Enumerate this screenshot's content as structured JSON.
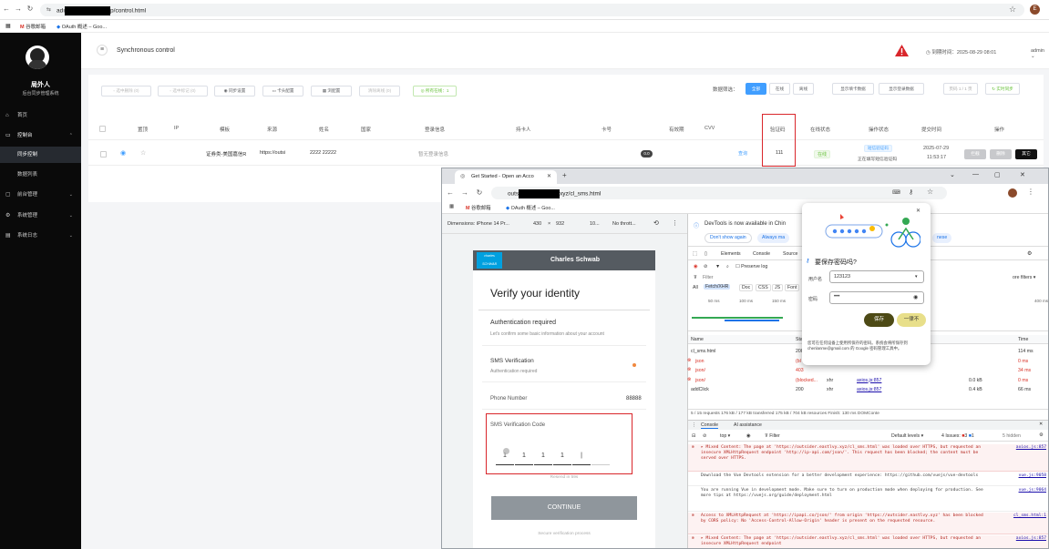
{
  "browser": {
    "url_prefix": "adı",
    "url_suffix": "p/control.html",
    "profile_initial": "E",
    "star": "☆",
    "bookmarks": [
      {
        "icon": "M",
        "label": "谷歌邮箱"
      },
      {
        "icon": "◆",
        "label": "OAuth 概述 – Goo..."
      }
    ]
  },
  "sidebar": {
    "brand_name": "局外人",
    "brand_sub": "后台同步管理系统",
    "items": [
      {
        "label": "首页",
        "icon": "⌂",
        "arrow": ""
      },
      {
        "label": "控制台",
        "icon": "▭",
        "arrow": "⌃"
      },
      {
        "label": "同步控制",
        "icon": "",
        "arrow": ""
      },
      {
        "label": "数据列表",
        "icon": "",
        "arrow": ""
      },
      {
        "label": "前台管理",
        "icon": "▢",
        "arrow": "⌄"
      },
      {
        "label": "系统管理",
        "icon": "⚙",
        "arrow": "⌄"
      },
      {
        "label": "系统日志",
        "icon": "▤",
        "arrow": "⌄"
      }
    ]
  },
  "header": {
    "menu_icon": "≡",
    "title": "Synchronous control",
    "expire_label": "到期时间：2025-08-29 08:01",
    "user": "admin",
    "user_arrow": "⌄"
  },
  "toolbar": {
    "buttons": [
      "选中删除 (0)",
      "选中标记 (0)",
      "同步设置",
      "卡头配置",
      "浏配置",
      "清除离线 (0)",
      "所有在线：1"
    ],
    "filter_label": "数据筛选：",
    "filter_all": "全部",
    "filter_online": "在线",
    "filter_offline": "离线",
    "show_card": "显示填卡数据",
    "show_login": "显示登录数据",
    "pager": "页码 1 / 1 页",
    "realtime": "实时同步"
  },
  "table": {
    "headers": [
      "置顶",
      "IP",
      "模板",
      "来源",
      "姓名",
      "国家",
      "登录信息",
      "持卡人",
      "卡号",
      "有效期",
      "CVV",
      "验证码",
      "在线状态",
      "操作状态",
      "提交时间",
      "操作"
    ],
    "row": {
      "template": "证券类-美国嘉信R",
      "source": "https://outsi",
      "name": "2222 22222",
      "login_info": "暂无登录信息",
      "card_badge": "0.0",
      "cvv_link": "查询",
      "code": "111",
      "online": "在线",
      "op_status_tag": "短信验证码",
      "op_status_text": "正在填写短信验证码",
      "time_date": "2025-07-29",
      "time_clock": "11:53:17",
      "actions": [
        "拦截",
        "删除",
        "其它"
      ]
    }
  },
  "inner": {
    "tab_title": "Get Started - Open an Acco",
    "tab_close": "✕",
    "new_tab": "+",
    "url_prefix": "outs",
    "url_suffix": "xyz/cl_sms.html",
    "bookmarks": [
      "谷歌邮箱",
      "OAuth 概述 – Goo..."
    ],
    "device_bar": {
      "dimensions": "Dimensions: iPhone 14 Pr...",
      "width": "430",
      "x": "×",
      "height": "932",
      "zoom": "10...",
      "throttle": "No thrott..."
    },
    "phone": {
      "logo": "charles SCHWAB",
      "brand": "Charles Schwab",
      "heading": "Verify your identity",
      "auth_title": "Authentication required",
      "auth_sub": "Let's confirm some basic information about your account",
      "sms_title": "SMS Verification",
      "sms_sub": "Authentication required",
      "phone_label": "Phone Number",
      "phone_value": "88888",
      "code_label": "SMS Verification Code",
      "digits": [
        "1",
        "1",
        "1",
        "1",
        "|",
        ""
      ],
      "resend": "Resend in 59s",
      "continue": "CONTINUE",
      "secure": "Secure verification process"
    },
    "devtools": {
      "banner": "DevTools is now available in Chin",
      "dont_show": "Don't show again",
      "always": "Always ma",
      "chinese": "nese",
      "tabs": [
        "Elements",
        "Console",
        "Source"
      ],
      "preserve": "Preserve log",
      "filter": "Filter",
      "more_filters": "ore filters ▾",
      "types": [
        "All",
        "Fetch/XHR",
        "Doc",
        "CSS",
        "JS",
        "Font"
      ],
      "timeline": [
        "50 ms",
        "100 ms",
        "150 ms",
        "400 ms"
      ],
      "col_name": "Name",
      "col_status": "Sta",
      "col_time": "Time",
      "requests": [
        {
          "name": "cl_sms.html",
          "status": "200",
          "type": "",
          "initiator": "",
          "size": "",
          "time": "114 ms",
          "err": false
        },
        {
          "name": "json",
          "status": "(bl",
          "type": "",
          "initiator": "",
          "size": "",
          "time": "0 ms",
          "err": true
        },
        {
          "name": "json/",
          "status": "403",
          "type": "",
          "initiator": "",
          "size": "",
          "time": "34 ms",
          "err": true
        },
        {
          "name": "json/",
          "status": "(blocked...",
          "type": "xhr",
          "initiator": "axios.js:857",
          "size": "0.0 kB",
          "time": "0 ms",
          "err": true
        },
        {
          "name": "addClick",
          "status": "200",
          "type": "xhr",
          "initiator": "axios.js:857",
          "size": "0.4 kB",
          "time": "66 ms",
          "err": false
        }
      ],
      "summary": "5 / 15 requests   176 kB / 177 kB transferred   175 kB / 704 kB resources   Finish: 130 ms   DOMConte",
      "console_tabs": [
        "Console",
        "AI assistance"
      ],
      "top": "top ▾",
      "console_filter": "Filter",
      "levels": "Default levels ▾",
      "issues": "4 Issues:",
      "issues_err": "3",
      "issues_info": "1",
      "hidden": "5 hidden",
      "log": [
        {
          "kind": "err",
          "text": "▸ Mixed Content: The page at 'https://outsider.eastlvy.xyz/cl_sms.html' was loaded over HTTPS, but requested an insecure XMLHttpRequest endpoint 'http://ip-api.com/json/'. This request has been blocked; the content must be served over HTTPS.",
          "src": "axios.js:857"
        },
        {
          "kind": "info",
          "text": "Download the Vue Devtools extension for a better development experience: https://github.com/vuejs/vue-devtools",
          "src": "vue.js:9058"
        },
        {
          "kind": "info",
          "text": "You are running Vue in development mode. Make sure to turn on production mode when deploying for production. See more tips at https://vuejs.org/guide/deployment.html",
          "src": "vue.js:9064"
        },
        {
          "kind": "err",
          "text": "Access to XMLHttpRequest at 'https://ipapi.co/json/' from origin 'https://outsider.eastlvy.xyz' has been blocked by CORS policy: No 'Access-Control-Allow-Origin' header is present on the requested resource.",
          "src": "cl_sms.html:1"
        },
        {
          "kind": "err",
          "text": "▸ Mixed Content: The page at 'https://outsider.eastlvy.xyz/cl_sms.html' was loaded over HTTPS, but requested an insecure XMLHttpRequest endpoint",
          "src": "axios.js:857"
        }
      ]
    },
    "password_popup": {
      "title": "要保存密码吗?",
      "user_label": "用户名",
      "user_value": "123123",
      "pass_label": "密码",
      "pass_value": "•••",
      "save": "保存",
      "never": "一律不",
      "footer": "您可在任何设备上使用所保存的密码。系统会将所保存到 chenlanme@gmail.com 的 Google 密码管理工具中。"
    },
    "window_controls": [
      "⌄",
      "—",
      "▢",
      "✕"
    ]
  },
  "colors": {
    "accent": "#409eff",
    "danger": "#d9262b",
    "success": "#67c23a",
    "sidebar": "#0a0a0a"
  }
}
